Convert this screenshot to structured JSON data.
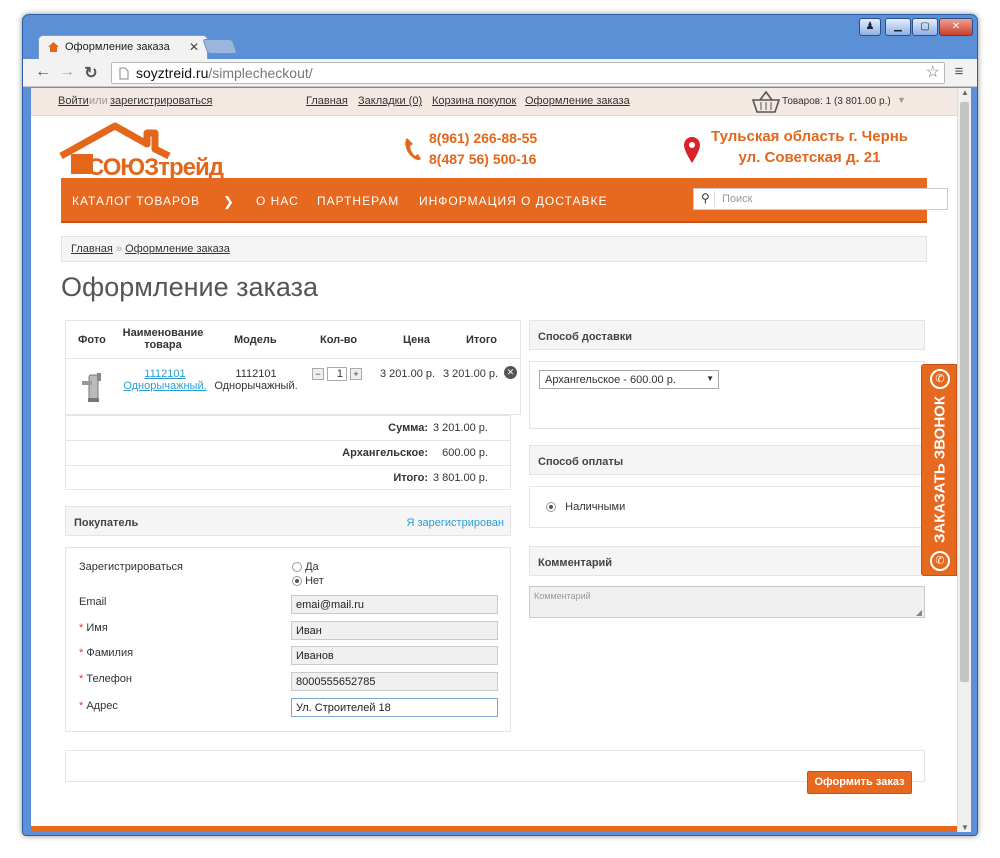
{
  "browser": {
    "tab_title": "Оформление заказа",
    "tab_close": "✕",
    "url_domain": "soyztreid.ru",
    "url_path": "/simplecheckout/"
  },
  "topbar": {
    "login": "Войти",
    "or": "или",
    "register": "зарегистрироваться",
    "links": [
      "Главная",
      "Закладки (0)",
      "Корзина покупок",
      "Оформление заказа"
    ],
    "cart": "Товаров: 1 (3 801.00 р.)"
  },
  "header": {
    "logo_text": "СОЮЗтрейд",
    "phone1": "8(961) 266-88-55",
    "phone2": "8(487 56) 500-16",
    "address1": "Тульская область г. Чернь",
    "address2": "ул. Советская д. 21"
  },
  "menu": {
    "items": [
      "КАТАЛОГ ТОВАРОВ",
      "О НАС",
      "ПАРТНЕРАМ",
      "ИНФОРМАЦИЯ О ДОСТАВКЕ"
    ],
    "search_placeholder": "Поиск"
  },
  "breadcrumb": {
    "home": "Главная",
    "sep": "»",
    "current": "Оформление заказа"
  },
  "page_title": "Оформление заказа",
  "cart_table": {
    "headers": [
      "Фото",
      "Наименование товара",
      "Модель",
      "Кол-во",
      "Цена",
      "Итого"
    ],
    "row": {
      "name_line1": "1112101",
      "name_line2": "Однорычажный.",
      "model_line1": "1112101",
      "model_line2": "Однорычажный.",
      "qty": "1",
      "price": "3 201.00 р.",
      "total": "3 201.00 р."
    },
    "totals": [
      {
        "label": "Сумма:",
        "value": "3 201.00 р."
      },
      {
        "label": "Архангельское:",
        "value": "600.00 р."
      },
      {
        "label": "Итого:",
        "value": "3 801.00 р."
      }
    ]
  },
  "customer": {
    "title": "Покупатель",
    "registered_link": "Я зарегистрирован",
    "register_label": "Зарегистрироваться",
    "opt_yes": "Да",
    "opt_no": "Нет",
    "fields": [
      {
        "label": "Email",
        "required": false,
        "value": "emai@mail.ru"
      },
      {
        "label": "Имя",
        "required": true,
        "value": "Иван"
      },
      {
        "label": "Фамилия",
        "required": true,
        "value": "Иванов"
      },
      {
        "label": "Телефон",
        "required": true,
        "value": "8000555652785"
      },
      {
        "label": "Адрес",
        "required": true,
        "value": "Ул. Строителей 18"
      }
    ],
    "required_mark": "*"
  },
  "delivery": {
    "title": "Способ доставки",
    "selected": "Архангельское - 600.00 р."
  },
  "payment": {
    "title": "Способ оплаты",
    "option": "Наличными"
  },
  "comment": {
    "title": "Комментарий",
    "placeholder": "Комментарий"
  },
  "order_button": "Оформить заказ",
  "callback_label": "ЗАКАЗАТЬ ЗВОНОК",
  "colors": {
    "accent": "#e7681f",
    "link": "#2a9fd6"
  }
}
